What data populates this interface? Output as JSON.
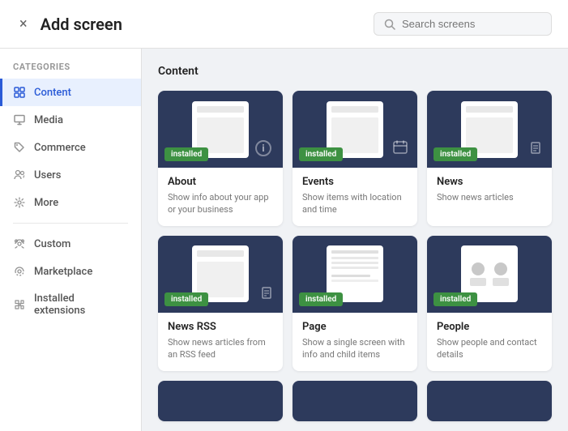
{
  "header": {
    "close_label": "×",
    "title": "Add screen",
    "search_placeholder": "Search screens"
  },
  "sidebar": {
    "section_title": "Categories",
    "items": [
      {
        "id": "content",
        "label": "Content",
        "icon": "grid-icon",
        "active": true
      },
      {
        "id": "media",
        "label": "Media",
        "icon": "monitor-icon",
        "active": false
      },
      {
        "id": "commerce",
        "label": "Commerce",
        "icon": "tag-icon",
        "active": false
      },
      {
        "id": "users",
        "label": "Users",
        "icon": "users-icon",
        "active": false
      },
      {
        "id": "more",
        "label": "More",
        "icon": "gear-icon",
        "active": false
      }
    ],
    "divider": true,
    "extra_items": [
      {
        "id": "custom",
        "label": "Custom",
        "icon": "custom-icon"
      },
      {
        "id": "marketplace",
        "label": "Marketplace",
        "icon": "marketplace-icon"
      },
      {
        "id": "installed-extensions",
        "label": "Installed extensions",
        "icon": "puzzle-icon"
      }
    ]
  },
  "main": {
    "section_title": "Content",
    "cards": [
      {
        "id": "about",
        "title": "About",
        "description": "Show info about your app or your business",
        "installed": true,
        "installed_label": "Installed"
      },
      {
        "id": "events",
        "title": "Events",
        "description": "Show items with location and time",
        "installed": true,
        "installed_label": "Installed"
      },
      {
        "id": "news",
        "title": "News",
        "description": "Show news articles",
        "installed": true,
        "installed_label": "Installed"
      },
      {
        "id": "news-rss",
        "title": "News RSS",
        "description": "Show news articles from an RSS feed",
        "installed": true,
        "installed_label": "Installed"
      },
      {
        "id": "page",
        "title": "Page",
        "description": "Show a single screen with info and child items",
        "installed": true,
        "installed_label": "Installed"
      },
      {
        "id": "people",
        "title": "People",
        "description": "Show people and contact details",
        "installed": true,
        "installed_label": "Installed"
      }
    ]
  }
}
